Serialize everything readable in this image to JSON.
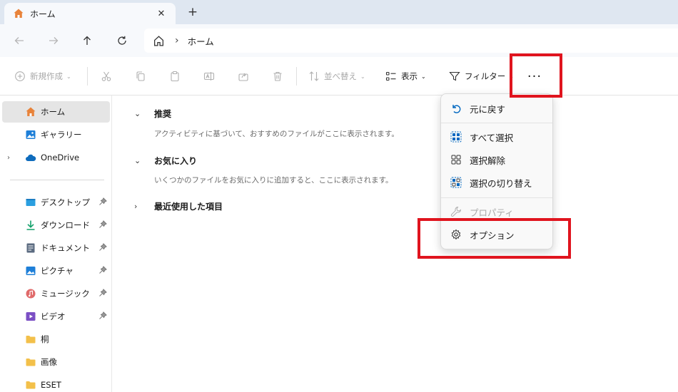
{
  "tab": {
    "title": "ホーム",
    "close_label": "✕",
    "new_tab_label": "+"
  },
  "address": {
    "separator": "›",
    "current": "ホーム"
  },
  "toolbar": {
    "new_label": "新規作成",
    "sort_label": "並べ替え",
    "view_label": "表示",
    "filter_label": "フィルター",
    "more_label": "···"
  },
  "sidebar": {
    "home": "ホーム",
    "gallery": "ギャラリー",
    "onedrive": "OneDrive",
    "desktop": "デスクトップ",
    "downloads": "ダウンロード",
    "documents": "ドキュメント",
    "pictures": "ピクチャ",
    "music": "ミュージック",
    "videos": "ビデオ",
    "folder1": "桐",
    "folder2": "画像",
    "folder3": "ESET"
  },
  "main": {
    "recommended_title": "推奨",
    "recommended_desc": "アクティビティに基づいて、おすすめのファイルがここに表示されます。",
    "favorites_title": "お気に入り",
    "favorites_desc": "いくつかのファイルをお気に入りに追加すると、ここに表示されます。",
    "recent_title": "最近使用した項目"
  },
  "menu": {
    "undo": "元に戻す",
    "select_all": "すべて選択",
    "select_none": "選択解除",
    "invert_selection": "選択の切り替え",
    "properties": "プロパティ",
    "options": "オプション"
  },
  "colors": {
    "accent": "#0067c0",
    "highlight": "#e0141e",
    "folder": "#f3c04a"
  }
}
